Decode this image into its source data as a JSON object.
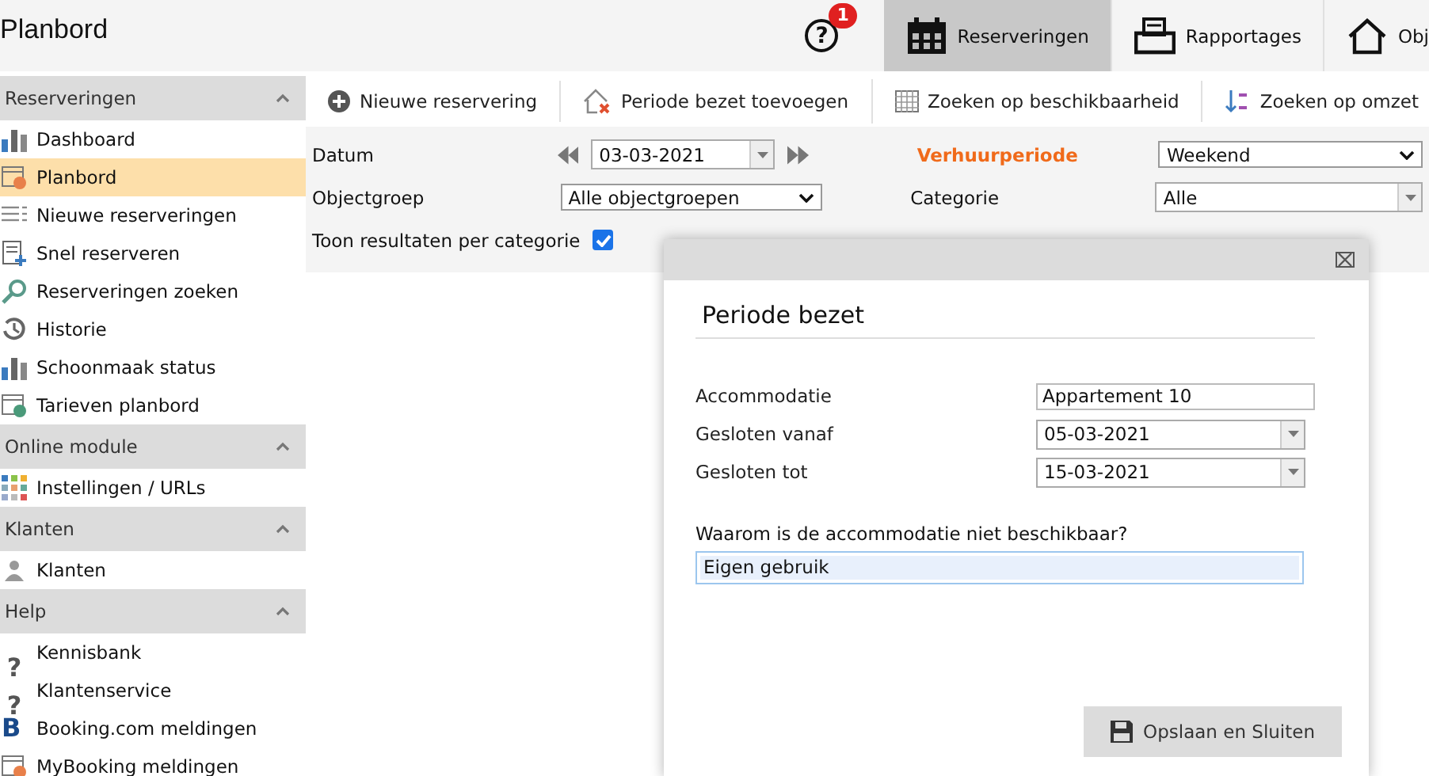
{
  "header": {
    "title": "Planbord",
    "help_icon_text": "?",
    "help_badge": "1",
    "nav": [
      {
        "label": "Reserveringen",
        "selected": true
      },
      {
        "label": "Rapportages",
        "selected": false
      },
      {
        "label": "Obj",
        "selected": false
      }
    ]
  },
  "sidebar": {
    "sections": [
      {
        "title": "Reserveringen",
        "expanded": true,
        "items": [
          {
            "label": "Dashboard",
            "selected": false
          },
          {
            "label": "Planbord",
            "selected": true
          },
          {
            "label": "Nieuwe reserveringen",
            "selected": false
          },
          {
            "label": "Snel reserveren",
            "selected": false
          },
          {
            "label": "Reserveringen zoeken",
            "selected": false
          },
          {
            "label": "Historie",
            "selected": false
          },
          {
            "label": "Schoonmaak status",
            "selected": false
          },
          {
            "label": "Tarieven planbord",
            "selected": false
          }
        ]
      },
      {
        "title": "Online module",
        "expanded": true,
        "items": [
          {
            "label": "Instellingen / URLs",
            "selected": false
          }
        ]
      },
      {
        "title": "Klanten",
        "expanded": true,
        "items": [
          {
            "label": "Klanten",
            "selected": false
          }
        ]
      },
      {
        "title": "Help",
        "expanded": true,
        "items": [
          {
            "label": "Kennisbank",
            "selected": false,
            "icon_text": "?"
          },
          {
            "label": "Klantenservice",
            "selected": false,
            "icon_text": "?"
          },
          {
            "label": "Booking.com meldingen",
            "selected": false,
            "icon_text": "B"
          },
          {
            "label": "MyBooking meldingen",
            "selected": false
          }
        ]
      }
    ]
  },
  "toolbar": [
    "Nieuwe reservering",
    "Periode bezet toevoegen",
    "Zoeken op beschikbaarheid",
    "Zoeken op omzet"
  ],
  "filters": {
    "datum_label": "Datum",
    "datum": "03-03-2021",
    "objectgroep_label": "Objectgroep",
    "objectgroep": "Alle objectgroepen",
    "verhuurperiode_label": "Verhuurperiode",
    "verhuurperiode": "Weekend",
    "categorie_label": "Categorie",
    "categorie": "Alle",
    "per_categorie_label": "Toon resultaten per categorie",
    "per_categorie_checked": true
  },
  "dialog": {
    "title": "Periode bezet",
    "fields": [
      {
        "label": "Accommodatie",
        "value": "Appartement 10",
        "kind": "text"
      },
      {
        "label": "Gesloten vanaf",
        "value": "05-03-2021",
        "kind": "date"
      },
      {
        "label": "Gesloten tot",
        "value": "15-03-2021",
        "kind": "date"
      }
    ],
    "question": "Waarom is de accommodatie niet beschikbaar?",
    "reason": "Eigen gebruik",
    "save_button": "Opslaan en Sluiten"
  }
}
